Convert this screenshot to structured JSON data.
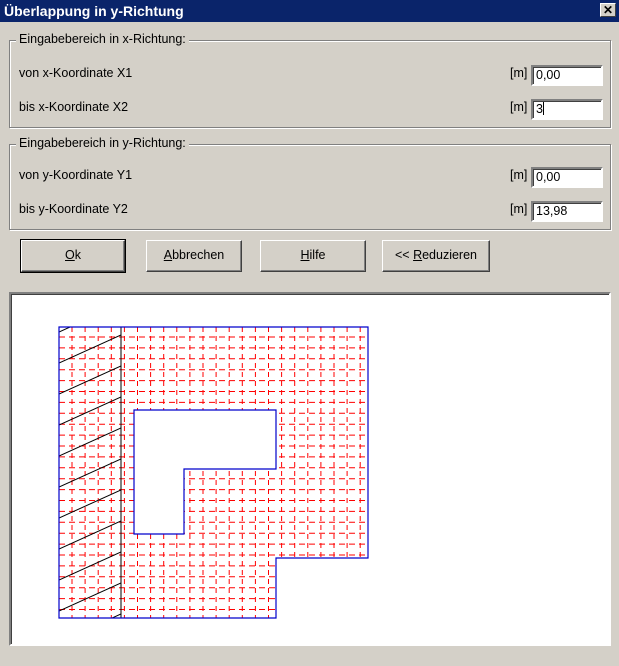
{
  "window": {
    "title": "Überlappung in y-Richtung",
    "close_glyph": "✕"
  },
  "group_x": {
    "title": "Eingabebereich in x-Richtung:",
    "rows": [
      {
        "label": "von x-Koordinate X1",
        "unit": "[m]",
        "value": "0,00"
      },
      {
        "label": "bis x-Koordinate X2",
        "unit": "[m]",
        "value": "3"
      }
    ]
  },
  "group_y": {
    "title": "Eingabebereich in y-Richtung:",
    "rows": [
      {
        "label": "von y-Koordinate Y1",
        "unit": "[m]",
        "value": "0,00"
      },
      {
        "label": "bis y-Koordinate Y2",
        "unit": "[m]",
        "value": "13,98"
      }
    ]
  },
  "buttons": {
    "ok": {
      "hotkey": "O",
      "rest": "k"
    },
    "cancel": {
      "hotkey": "A",
      "rest": "bbrechen"
    },
    "help": {
      "hotkey": "H",
      "rest": "ilfe"
    },
    "reduce": {
      "prefix": "<< ",
      "hotkey": "R",
      "rest": "eduzieren"
    }
  },
  "colors": {
    "outline": "#0000cc",
    "grid": "#ff0000",
    "hatch": "#000000",
    "titlebar": "#0a246a"
  }
}
